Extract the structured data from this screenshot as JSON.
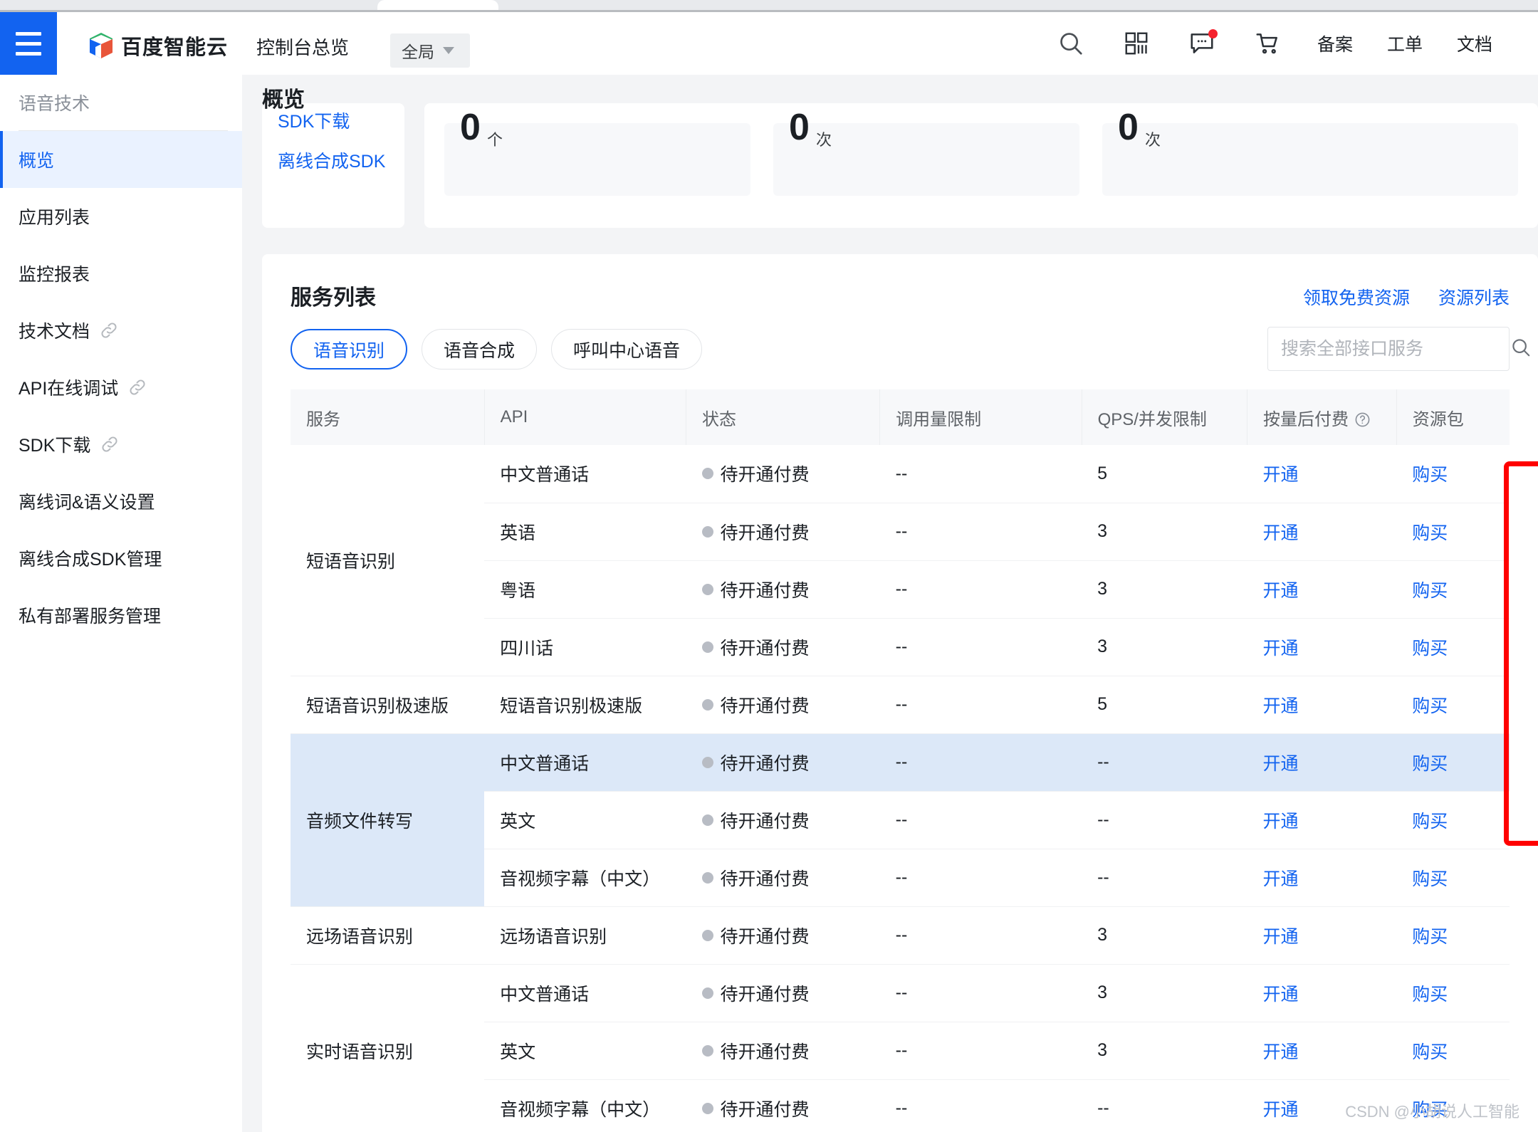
{
  "header": {
    "brand_name": "百度智能云",
    "console_title": "控制台总览",
    "region": "全局",
    "icons": [
      "search-icon",
      "apps-icon",
      "message-icon",
      "cart-icon"
    ],
    "links": [
      "备案",
      "工单",
      "文档"
    ]
  },
  "sidebar": {
    "group_title": "语音技术",
    "items": [
      {
        "label": "概览",
        "active": true,
        "external": false
      },
      {
        "label": "应用列表",
        "active": false,
        "external": false
      },
      {
        "label": "监控报表",
        "active": false,
        "external": false
      },
      {
        "label": "技术文档",
        "active": false,
        "external": true
      },
      {
        "label": "API在线调试",
        "active": false,
        "external": true
      },
      {
        "label": "SDK下载",
        "active": false,
        "external": true
      },
      {
        "label": "离线词&语义设置",
        "active": false,
        "external": false
      },
      {
        "label": "离线合成SDK管理",
        "active": false,
        "external": false
      },
      {
        "label": "私有部署服务管理",
        "active": false,
        "external": false
      }
    ]
  },
  "main": {
    "page_title": "概览",
    "quick_links": [
      "SDK下载",
      "离线合成SDK"
    ],
    "stats": [
      {
        "value": "0",
        "unit": "个"
      },
      {
        "value": "0",
        "unit": "次"
      },
      {
        "value": "0",
        "unit": "次"
      }
    ]
  },
  "service_panel": {
    "title": "服务列表",
    "links": [
      "领取免费资源",
      "资源列表"
    ],
    "tabs": [
      {
        "label": "语音识别",
        "active": true
      },
      {
        "label": "语音合成",
        "active": false
      },
      {
        "label": "呼叫中心语音",
        "active": false
      }
    ],
    "search": {
      "placeholder": "搜索全部接口服务",
      "value": ""
    },
    "columns": [
      "服务",
      "API",
      "状态",
      "调用量限制",
      "QPS/并发限制",
      "按量后付费",
      "资源包"
    ],
    "help_icon": "question-circle-icon",
    "rows": [
      {
        "group": "短语音识别",
        "group_span": 4,
        "group_highlight": false,
        "highlight": false,
        "api": "中文普通话",
        "status": "待开通付费",
        "quota": "--",
        "qps": "5",
        "pay": "开通",
        "pack": "购买"
      },
      {
        "group": null,
        "group_span": 0,
        "group_highlight": false,
        "highlight": false,
        "api": "英语",
        "status": "待开通付费",
        "quota": "--",
        "qps": "3",
        "pay": "开通",
        "pack": "购买"
      },
      {
        "group": null,
        "group_span": 0,
        "group_highlight": false,
        "highlight": false,
        "api": "粤语",
        "status": "待开通付费",
        "quota": "--",
        "qps": "3",
        "pay": "开通",
        "pack": "购买"
      },
      {
        "group": null,
        "group_span": 0,
        "group_highlight": false,
        "highlight": false,
        "api": "四川话",
        "status": "待开通付费",
        "quota": "--",
        "qps": "3",
        "pay": "开通",
        "pack": "购买"
      },
      {
        "group": "短语音识别极速版",
        "group_span": 1,
        "group_highlight": false,
        "highlight": false,
        "api": "短语音识别极速版",
        "status": "待开通付费",
        "quota": "--",
        "qps": "5",
        "pay": "开通",
        "pack": "购买"
      },
      {
        "group": "音频文件转写",
        "group_span": 3,
        "group_highlight": true,
        "highlight": true,
        "api": "中文普通话",
        "status": "待开通付费",
        "quota": "--",
        "qps": "--",
        "pay": "开通",
        "pack": "购买"
      },
      {
        "group": null,
        "group_span": 0,
        "group_highlight": false,
        "highlight": false,
        "api": "英文",
        "status": "待开通付费",
        "quota": "--",
        "qps": "--",
        "pay": "开通",
        "pack": "购买"
      },
      {
        "group": null,
        "group_span": 0,
        "group_highlight": false,
        "highlight": false,
        "api": "音视频字幕（中文）",
        "status": "待开通付费",
        "quota": "--",
        "qps": "--",
        "pay": "开通",
        "pack": "购买"
      },
      {
        "group": "远场语音识别",
        "group_span": 1,
        "group_highlight": false,
        "highlight": false,
        "api": "远场语音识别",
        "status": "待开通付费",
        "quota": "--",
        "qps": "3",
        "pay": "开通",
        "pack": "购买"
      },
      {
        "group": "实时语音识别",
        "group_span": 3,
        "group_highlight": false,
        "highlight": false,
        "api": "中文普通话",
        "status": "待开通付费",
        "quota": "--",
        "qps": "3",
        "pay": "开通",
        "pack": "购买"
      },
      {
        "group": null,
        "group_span": 0,
        "group_highlight": false,
        "highlight": false,
        "api": "英文",
        "status": "待开通付费",
        "quota": "--",
        "qps": "3",
        "pay": "开通",
        "pack": "购买"
      },
      {
        "group": null,
        "group_span": 0,
        "group_highlight": false,
        "highlight": false,
        "api": "音视频字幕（中文）",
        "status": "待开通付费",
        "quota": "--",
        "qps": "--",
        "pay": "开通",
        "pack": "购买"
      }
    ]
  },
  "watermark": "CSDN @小胡说人工智能",
  "colors": {
    "brand_blue": "#1263f0",
    "highlight_row": "#dce8f8",
    "annotation_red": "#ff0000",
    "status_dot": "#b8bcc4"
  }
}
